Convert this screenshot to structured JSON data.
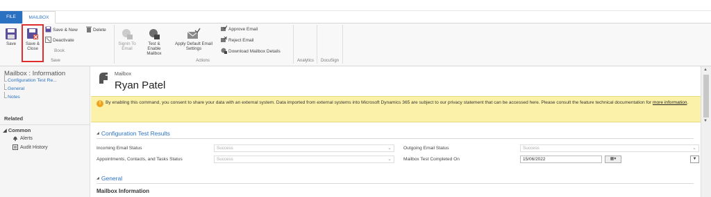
{
  "tabs": {
    "file": "FILE",
    "mailbox": "MAILBOX"
  },
  "ribbon": {
    "save": "Save",
    "save_close": "Save & Close",
    "save_new": "Save & New",
    "delete": "Delete",
    "deactivate": "Deactivate",
    "book": "Book",
    "group_save": "Save",
    "signin_to_email": "Signin To Email",
    "test_enable_mailbox": "Test & Enable Mailbox",
    "apply_default_email_settings": "Apply Default Email Settings",
    "approve_email": "Approve Email",
    "reject_email": "Reject Email",
    "download_mailbox_details": "Download Mailbox Details",
    "group_actions": "Actions",
    "group_analytics": "Analytics",
    "group_docusign": "DocuSign"
  },
  "left_nav": {
    "title": "Mailbox : Information",
    "links": [
      "Configuration Test Re...",
      "General",
      "Notes"
    ],
    "related": "Related",
    "common": "Common",
    "items": [
      "Alerts",
      "Audit History"
    ]
  },
  "header": {
    "entity_type": "Mailbox",
    "name": "Ryan Patel"
  },
  "notice": {
    "text": "By enabling this command, you consent to share your data with an external system. Data imported from external systems into Microsoft Dynamics 365 are subject to our privacy statement that can be accessed here. Please consult the feature technical documentation for ",
    "link": "more information",
    "end": "."
  },
  "sections": {
    "config_title": "Configuration Test Results",
    "general_title": "General",
    "mailbox_info": "Mailbox Information"
  },
  "fields": {
    "incoming_label": "Incoming Email Status",
    "incoming_value": "Success",
    "outgoing_label": "Outgoing Email Status",
    "outgoing_value": "Success",
    "act_label": "Appointments, Contacts, and Tasks Status",
    "act_value": "Success",
    "completed_label": "Mailbox Test Completed On",
    "completed_value": "15/06/2022"
  },
  "colors": {
    "accent": "#2b71c2",
    "notice_bg": "#fcf1a8",
    "highlight": "#e22b2b"
  }
}
